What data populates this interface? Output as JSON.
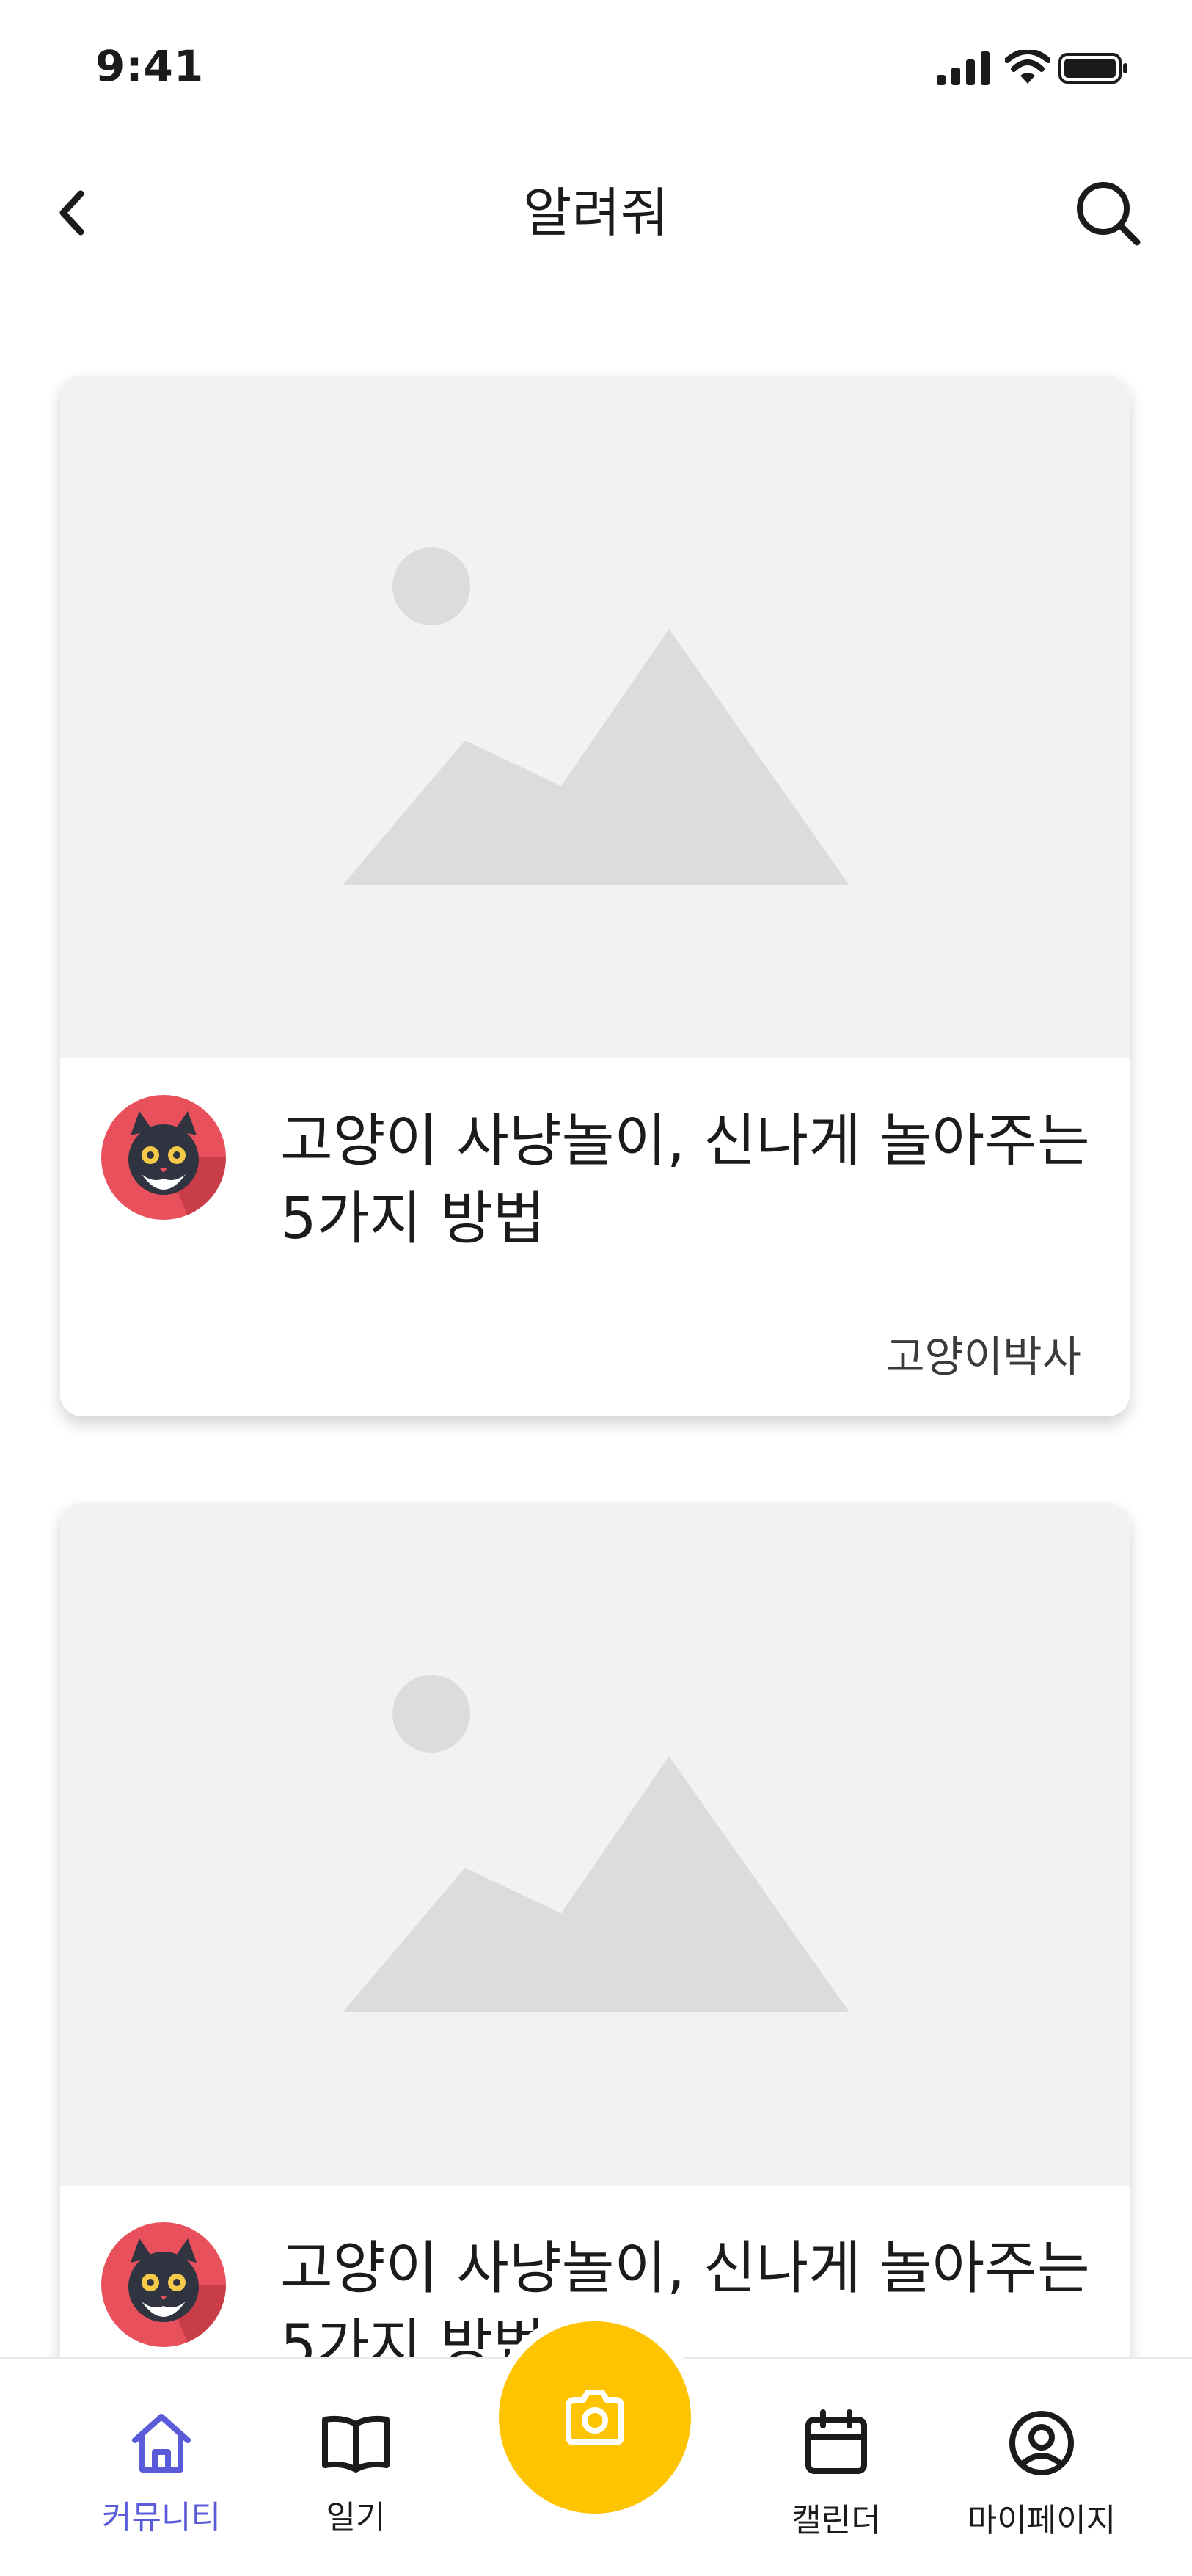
{
  "status_bar": {
    "time": "9:41"
  },
  "nav_bar": {
    "title": "알려줘"
  },
  "posts": [
    {
      "title": "고양이 사냥놀이, 신나게 놀아주는 5가지 방법",
      "author": "고양이박사"
    },
    {
      "title": "고양이 사냥놀이, 신나게 놀아주는 5가지 방법",
      "author": ""
    }
  ],
  "tab_bar": {
    "tabs": [
      {
        "label": "커뮤니티",
        "icon": "home-icon",
        "active": true
      },
      {
        "label": "일기",
        "icon": "book-icon",
        "active": false
      },
      {
        "label": "",
        "icon": "camera-icon",
        "active": false
      },
      {
        "label": "캘린더",
        "icon": "calendar-icon",
        "active": false
      },
      {
        "label": "마이페이지",
        "icon": "user-circle-icon",
        "active": false
      }
    ]
  },
  "colors": {
    "accent": "#5a5bd8",
    "camera_button": "#ffc400",
    "avatar_bg": "#e8505b",
    "image_placeholder": "#f2f2f2"
  }
}
